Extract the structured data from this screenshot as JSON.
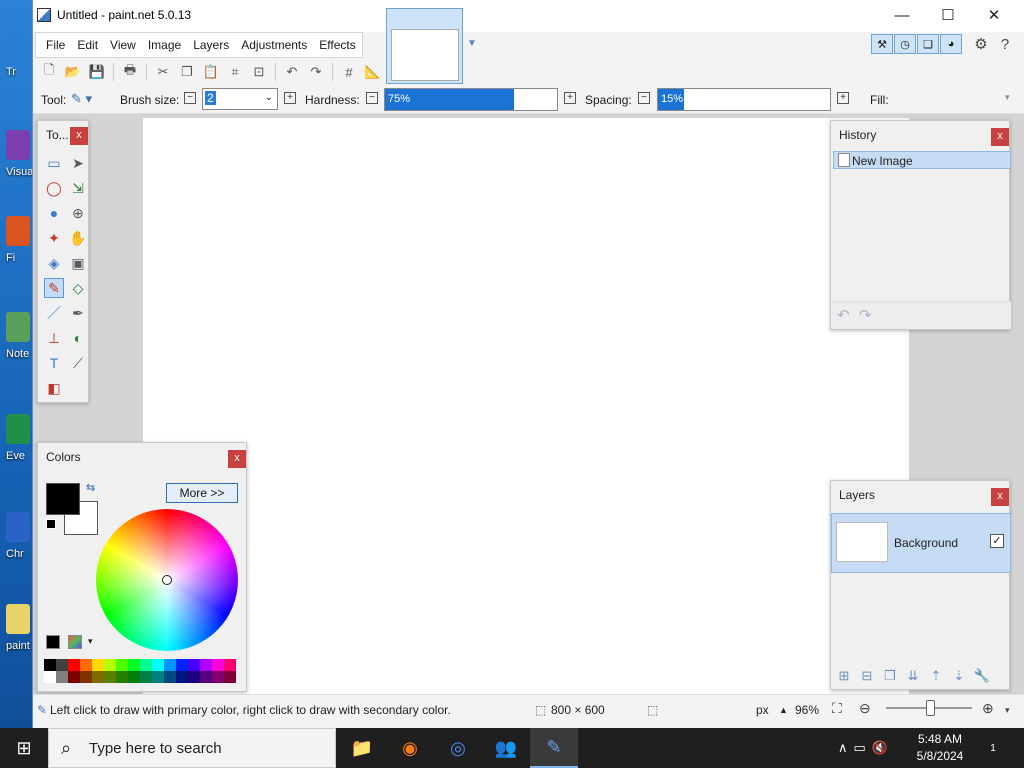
{
  "desktop": {
    "icons": [
      {
        "label": "Tr",
        "color": "#2a7fd4"
      },
      {
        "label": "Visua",
        "color": "#7b3fb0"
      },
      {
        "label": "Fi",
        "color": "#d9541e"
      },
      {
        "label": "Note",
        "color": "#5aa05a"
      },
      {
        "label": "Eve",
        "color": "#1f8f4a"
      },
      {
        "label": "Chr",
        "color": "#2b62c8"
      },
      {
        "label": "paint",
        "color": "#e8d36a"
      }
    ]
  },
  "window": {
    "title": "Untitled - paint.net 5.0.13",
    "controls": {
      "minimize": "—",
      "maximize": "☐",
      "close": "✕"
    }
  },
  "menu": [
    "File",
    "Edit",
    "View",
    "Image",
    "Layers",
    "Adjustments",
    "Effects"
  ],
  "toolbar": {
    "icons": [
      "new-icon",
      "open-icon",
      "save-icon",
      "print-icon",
      "cut-icon",
      "copy-icon",
      "paste-icon",
      "crop-icon",
      "deselect-icon",
      "undo-icon",
      "redo-icon",
      "grid-icon",
      "ruler-icon"
    ]
  },
  "right_tools": [
    "tools-icon",
    "history-icon",
    "layers-icon",
    "colors-icon"
  ],
  "options": {
    "tool_label": "Tool:",
    "brush_size_label": "Brush size:",
    "brush_size_value": "2",
    "hardness_label": "Hardness:",
    "hardness_value": "75%",
    "hardness_fraction": 0.75,
    "spacing_label": "Spacing:",
    "spacing_value": "15%",
    "spacing_fraction": 0.15,
    "fill_label": "Fill:"
  },
  "tools_panel": {
    "title": "To...",
    "close": "x",
    "tools": [
      {
        "name": "rectangle-select-tool",
        "glyph": "▭",
        "selected": false
      },
      {
        "name": "move-selected-tool",
        "glyph": "➤",
        "selected": false
      },
      {
        "name": "lasso-select-tool",
        "glyph": "◯",
        "selected": false
      },
      {
        "name": "move-selection-tool",
        "glyph": "⇲",
        "selected": false
      },
      {
        "name": "ellipse-select-tool",
        "glyph": "●",
        "selected": false
      },
      {
        "name": "zoom-tool",
        "glyph": "⊕",
        "selected": false
      },
      {
        "name": "magic-wand-tool",
        "glyph": "✦",
        "selected": false
      },
      {
        "name": "pan-tool",
        "glyph": "✋",
        "selected": false
      },
      {
        "name": "paint-bucket-tool",
        "glyph": "◈",
        "selected": false
      },
      {
        "name": "gradient-tool",
        "glyph": "▣",
        "selected": false
      },
      {
        "name": "paintbrush-tool",
        "glyph": "✎",
        "selected": true
      },
      {
        "name": "eraser-tool",
        "glyph": "◇",
        "selected": false
      },
      {
        "name": "pencil-tool",
        "glyph": "／",
        "selected": false
      },
      {
        "name": "color-picker-tool",
        "glyph": "✒",
        "selected": false
      },
      {
        "name": "clone-stamp-tool",
        "glyph": "⊥",
        "selected": false
      },
      {
        "name": "recolor-tool",
        "glyph": "◐",
        "selected": false
      },
      {
        "name": "text-tool",
        "glyph": "T",
        "selected": false
      },
      {
        "name": "line-curve-tool",
        "glyph": "⟋",
        "selected": false
      },
      {
        "name": "shapes-tool",
        "glyph": "◧",
        "selected": false
      }
    ]
  },
  "history_panel": {
    "title": "History",
    "close": "x",
    "items": [
      "New Image"
    ],
    "undo": "↶",
    "redo": "↷"
  },
  "layers_panel": {
    "title": "Layers",
    "close": "x",
    "layers": [
      {
        "name": "Background",
        "visible": true
      }
    ],
    "buttons": [
      "add-layer-icon",
      "delete-layer-icon",
      "duplicate-layer-icon",
      "merge-layer-icon",
      "move-up-icon",
      "move-down-icon",
      "layer-properties-icon"
    ]
  },
  "colors_panel": {
    "title": "Colors",
    "close": "x",
    "more_label": "More >>",
    "primary_color": "#000000",
    "secondary_color": "#ffffff",
    "palette_top": [
      "#000000",
      "#404040",
      "#ff0000",
      "#ff6a00",
      "#ffd800",
      "#b6ff00",
      "#4cff00",
      "#00ff21",
      "#00ff90",
      "#00ffff",
      "#0094ff",
      "#0026ff",
      "#4800ff",
      "#b200ff",
      "#ff00dc",
      "#ff006e"
    ],
    "palette_bottom": [
      "#ffffff",
      "#808080",
      "#7f0000",
      "#7f3300",
      "#7f6a00",
      "#5b7f00",
      "#267f00",
      "#007f0e",
      "#007f46",
      "#007f7f",
      "#004a7f",
      "#00137f",
      "#21007f",
      "#57007f",
      "#7f006e",
      "#7f0037"
    ]
  },
  "status_bar": {
    "hint": "Left click to draw with primary color, right click to draw with secondary color.",
    "image_size": "800 × 600",
    "units": "px",
    "zoom": "96%"
  },
  "taskbar": {
    "search_placeholder": "Type here to search",
    "apps": [
      "file-explorer-icon",
      "firefox-icon",
      "chrome-icon",
      "people-icon",
      "paintnet-icon"
    ],
    "time": "5:48 AM",
    "date": "5/8/2024",
    "notifications": "1"
  }
}
